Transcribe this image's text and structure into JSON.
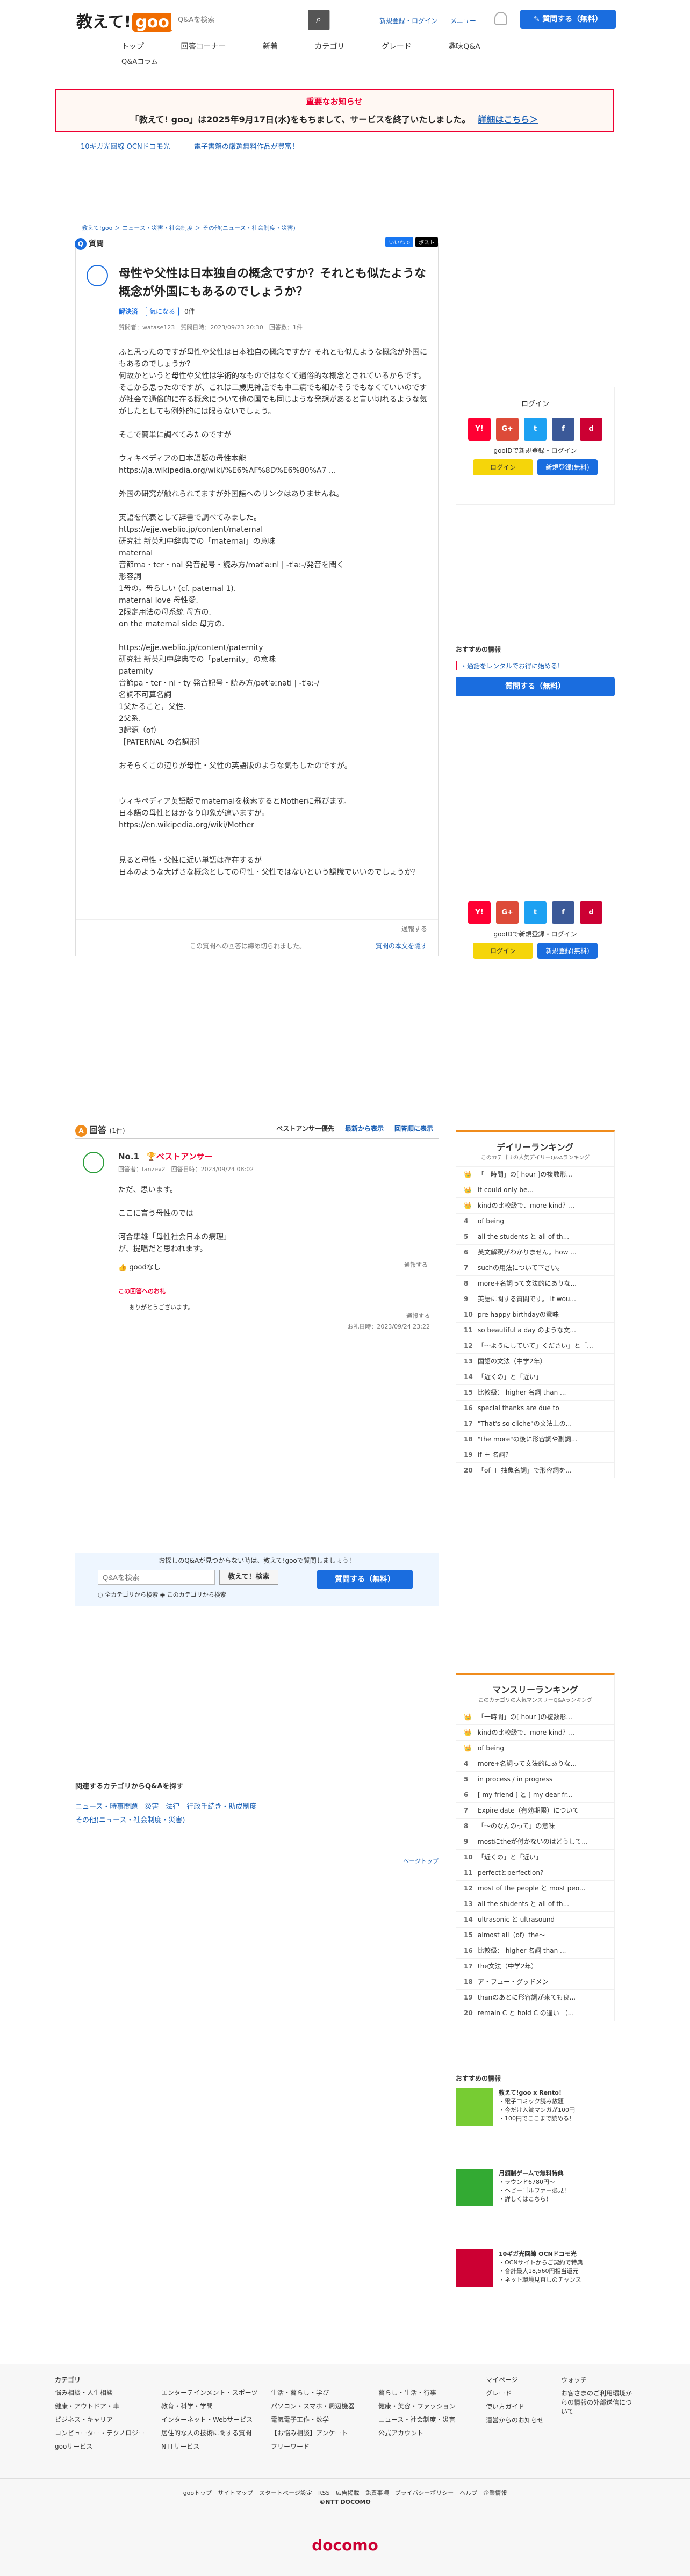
{
  "header": {
    "logo": "教えて!goo",
    "search_placeholder": "Q&Aを検索",
    "links": [
      "新規登録・ログイン",
      "メニュー"
    ],
    "ask": "質問する（無料）",
    "nav": [
      "トップ",
      "回答コーナー",
      "新着",
      "カテゴリ",
      "グレード",
      "趣味Q&A"
    ],
    "nav2": "Q&Aコラム"
  },
  "notice": {
    "title": "重要なお知らせ",
    "text": "「教えて! goo」は2025年9月17日(水)をもちまして、サービスを終了いたしました。",
    "link": "詳細はこちら＞"
  },
  "promo": [
    "10ギガ光回線 OCNドコモ光",
    "電子書籍の厳選無料作品が豊富！"
  ],
  "breadcrumb": "教えて!goo ＞ ニュース・災害・社会制度 ＞ その他(ニュース・社会制度・災害)",
  "question": {
    "label": "質問",
    "share": [
      "いいね 0",
      "ポスト"
    ],
    "title": "母性や父性は日本独自の概念ですか？それとも似たような概念が外国にもあるのでしょうか？",
    "status": "解決済",
    "tag": "気になる",
    "count": "0件",
    "meta": "質問者：watase123　質問日時：2023/09/23 20:30　回答数：1件",
    "body": "ふと思ったのですが母性や父性は日本独自の概念ですか？それとも似たような概念が外国にもあるのでしょうか？\n何故かというと母性や父性は学術的なものではなくて通俗的な概念とされているからです。\nそこから思ったのですが、これは二歳児神話でも中二病でも細かそうでもなくていいのですが社会で通俗的に在る概念について他の国でも同じような発想があると言い切れるような気がしたとしても例外的には限らないでしょう。\n\nそこで簡単に調べてみたのですが\n\nウィキペディアの日本語版の母性本能\nhttps://ja.wikipedia.org/wiki/%E6%AF%8D%E6%80%A7 ...\n\n外国の研究が触れられてますが外国語へのリンクはありませんね。\n\n英語を代表として辞書で調べてみました。\nhttps://ejje.weblio.jp/content/maternal\n研究社 新英和中辞典での「maternal」の意味\nmaternal\n音節ma・ter・nal 発音記号・読み方/mətˈəːnl | -tˈəː-/発音を聞く\n形容詞\n1母の，母らしい (cf. paternal 1).\nmaternal love 母性愛.\n2限定用法の母系統 母方の.\non the maternal side 母方の.\n\nhttps://ejje.weblio.jp/content/paternity\n研究社 新英和中辞典での「paternity」の意味\npaternity\n音節pa・ter・ni・ty 発音記号・読み方/pətˈəːnəti | -tˈəː-/\n名詞不可算名詞\n1父たること，父性.\n2父系.\n3起源（of）\n［PATERNAL の名詞形］\n\nおそらくこの辺りが母性・父性の英語版のような気もしたのですが。\n\n\nウィキペディア英語版でmaternalを検索するとMotherに飛びます。\n日本語の母性とはかなり印象が違いますが。\nhttps://en.wikipedia.org/wiki/Mother\n\n\n見ると母性・父性に近い単語は存在するが\n日本のような大げさな概念としての母性・父性ではないという認識でいいのでしょうか？",
    "report": "通報する",
    "closed": "この質問への回答は締め切られました。",
    "show_full": "質問の本文を隠す"
  },
  "login": {
    "title": "ログイン",
    "text": "gooIDで新規登録・ログイン",
    "login": "ログイン",
    "register": "新規登録(無料)",
    "sns": [
      "Y!",
      "G+",
      "t",
      "f",
      "d"
    ]
  },
  "recommend": {
    "title": "おすすめの情報",
    "item": "・通話をレンタルでお得に始める！",
    "ask": "質問する（無料）"
  },
  "answers": {
    "label": "回答",
    "count": "(1件)",
    "sort": [
      "ベストアンサー優先",
      "最新から表示",
      "回答順に表示"
    ],
    "no": "No.1",
    "best": "ベストアンサー",
    "meta": "回答者：fanzev2　回答日時：2023/09/24 08:02",
    "body": "ただ、思います。\n\nここに言う母性のでは\n\n河合隼雄「母性社会日本の病理」\nが、提唱だと思われます。",
    "good": "goodなし",
    "report": "通報する",
    "thanks_title": "この回答へのお礼",
    "thanks": "ありがとうございます。",
    "thanks_report": "通報する",
    "thanks_date": "お礼日時：2023/09/24 23:22"
  },
  "search_box": {
    "title": "お探しのQ&Aが見つからない時は、教えて!gooで質問しましょう！",
    "placeholder": "Q&Aを検索",
    "btn": "教えて！検索",
    "opt1": "全カテゴリから検索",
    "opt2": "このカテゴリから検索",
    "ask": "質問する（無料）"
  },
  "daily": {
    "title": "デイリーランキング",
    "sub": "このカテゴリの人気デイリーQ&Aランキング",
    "items": [
      "「一時間」の[ hour ]の複数形...",
      "it could only be...",
      "kindの比較級で、more kind？...",
      "of being",
      "all the students と all of th...",
      "英文解釈がわかりません。how ...",
      "suchの用法について下さい。",
      "more+名詞って文法的にありな...",
      "英語に関する質問です。 It wou...",
      "pre happy birthdayの意味",
      "so beautiful a day のような文...",
      "「〜ようにしていて」ください」と「...",
      "国語の文法（中学2年）",
      "「近くの」と「近い」",
      "比較級： higher 名詞 than ...",
      "special thanks are due to",
      "\"That's so cliche\"の文法上の...",
      "\"the more\"の後に形容詞や副詞...",
      "if ＋ 名詞？",
      "「of ＋ 抽象名詞」で形容詞を..."
    ]
  },
  "related": {
    "title": "関連するカテゴリからQ&Aを探す",
    "row1": [
      "ニュース・時事問題",
      "災害",
      "法律",
      "行政手続き・助成制度"
    ],
    "row2": "その他(ニュース・社会制度・災害)",
    "top": "ページトップ"
  },
  "monthly": {
    "title": "マンスリーランキング",
    "sub": "このカテゴリの人気マンスリーQ&Aランキング",
    "items": [
      "「一時間」の[ hour ]の複数形...",
      "kindの比較級で、more kind？...",
      "of being",
      "more+名詞って文法的にありな...",
      "in process / in progress",
      "[ my friend ] と [ my dear fr...",
      "Expire date（有効期限）について",
      "「〜のなんのって」の意味",
      "mostにtheが付かないのはどうして...",
      "「近くの」と「近い」",
      "perfectとperfection?",
      "most of the people と most peo...",
      "all the students と all of th...",
      "ultrasonic と ultrasound",
      "almost all（of）the〜",
      "比較級： higher 名詞 than ...",
      "the文法（中学2年）",
      "ア・フュー・グッドメン",
      "thanのあとに形容詞が来ても良...",
      "remain C と hold C の違い （..."
    ]
  },
  "ads": {
    "title": "おすすめの情報",
    "a": {
      "h": "教えて!goo x Rento！",
      "l": [
        "・電子コミック読み放題",
        "・今だけ入賞マンガが100円",
        "・100円でここまで読める！"
      ]
    },
    "b": {
      "h": "月額制ゲームで無料特典",
      "l": [
        "・ラウンド6780円〜",
        "・ヘビーゴルファー必見！",
        "・詳しくはこちら！"
      ]
    },
    "c": {
      "h": "10ギガ光回線 OCNドコモ光",
      "l": [
        "・OCNサイトからご契約で特典",
        "・合計最大18,560円相当還元",
        "・ネット環境見直しのチャンス"
      ]
    }
  },
  "footer": {
    "cat": "カテゴリ",
    "cols": [
      [
        "悩み相談・人生相談",
        "健康・アウトドア・車",
        "ビジネス・キャリア",
        "コンピューター・テクノロジー",
        "gooサービス"
      ],
      [
        "エンターテインメント・スポーツ",
        "教育・科学・学問",
        "インターネット・Webサービス",
        "居住的な人の技術に関する質問",
        "NTTサービス"
      ],
      [
        "生活・暮らし・学び",
        "パソコン・スマホ・周辺機器",
        "電気電子工作・数学",
        "【お悩み相談】アンケート",
        "フリーワード"
      ],
      [
        "暮らし・生活・行事",
        "健康・美容・ファッション",
        "ニュース・社会制度・災害",
        "公式アカウント"
      ]
    ],
    "right": [
      "マイページ",
      "グレード",
      "使い方ガイド",
      "運営からのお知らせ"
    ],
    "right2": [
      "ウォッチ",
      "お客さまのご利用環境からの情報の外部送信について"
    ],
    "bottom": "gooトップ　サイトマップ　スタートページ設定　RSS　広告掲載　免責事項　プライバシーポリシー　ヘルプ　企業情報",
    "copy": "©NTT DOCOMO",
    "brand": "docomo"
  }
}
